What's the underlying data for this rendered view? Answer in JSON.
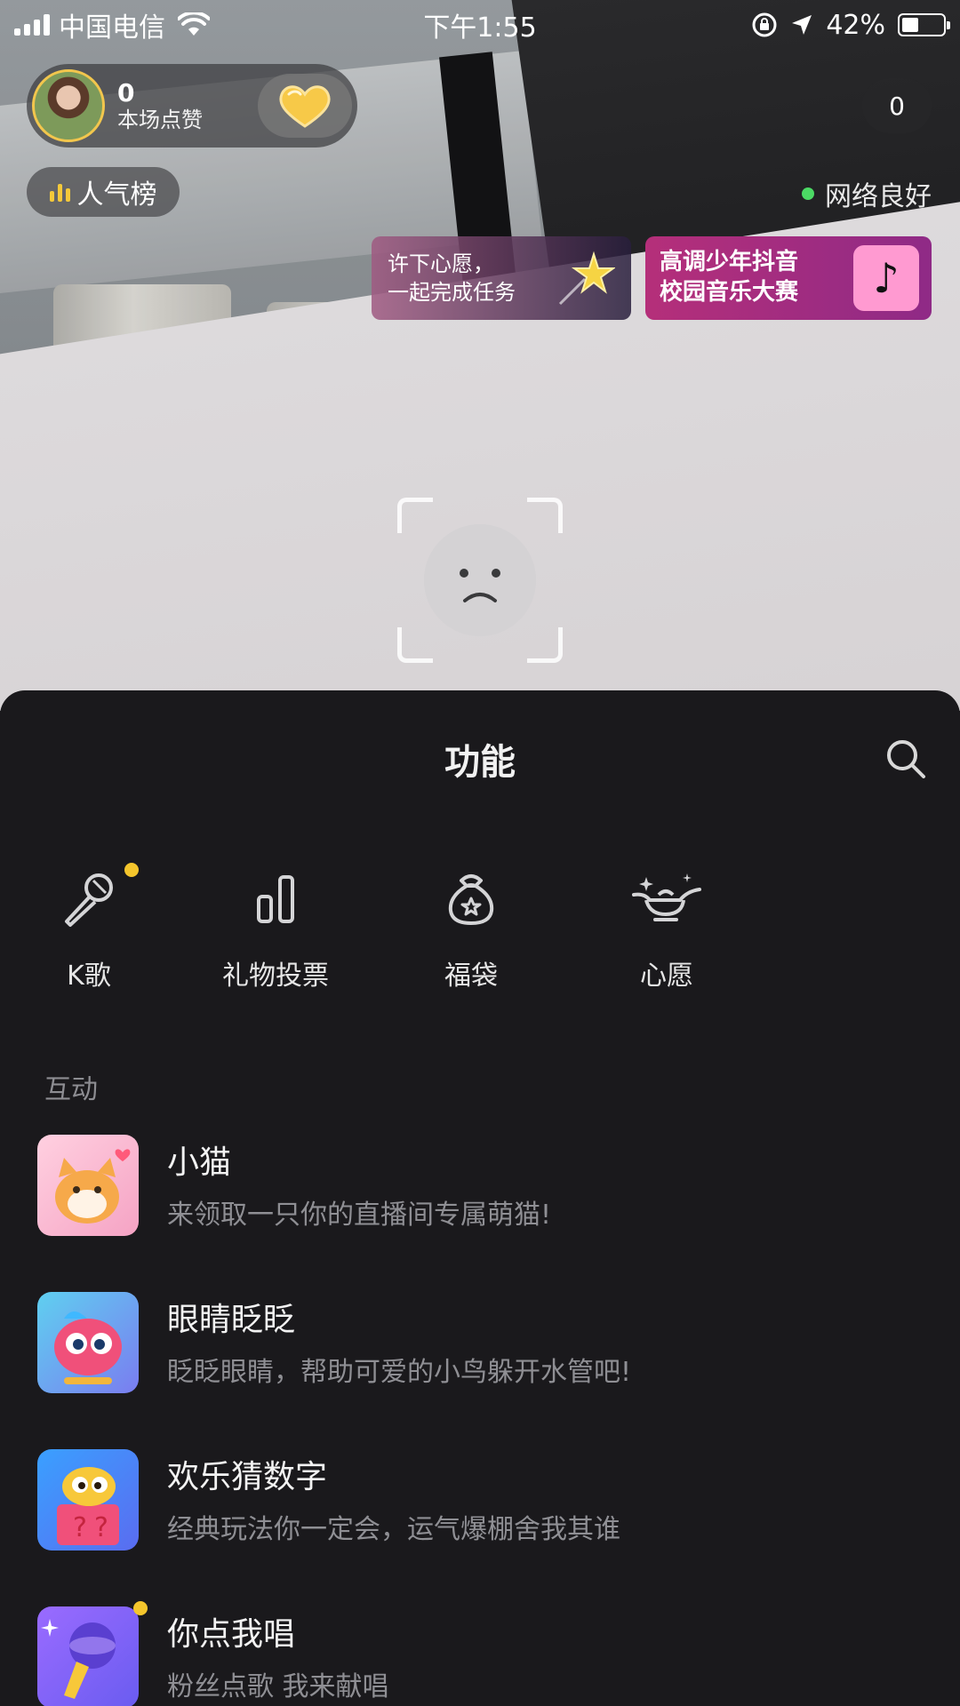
{
  "status_bar": {
    "carrier": "中国电信",
    "time": "下午1:55",
    "battery": "42%",
    "battery_level": 0.42
  },
  "live": {
    "like_count": "0",
    "like_label": "本场点赞",
    "viewer_count": "0",
    "rank_label": "人气榜",
    "network_status": "网络良好",
    "wish_banner": [
      "许下心愿，",
      "一起完成任务"
    ],
    "music_banner": [
      "高调少年抖音",
      "校园音乐大赛"
    ]
  },
  "sheet": {
    "title": "功能",
    "features": [
      {
        "label": "K歌",
        "icon": "microphone-icon",
        "badge": true
      },
      {
        "label": "礼物投票",
        "icon": "bar-chart-icon",
        "badge": false
      },
      {
        "label": "福袋",
        "icon": "lucky-bag-icon",
        "badge": false
      },
      {
        "label": "心愿",
        "icon": "magic-lamp-icon",
        "badge": false
      }
    ],
    "section_label": "互动",
    "games": [
      {
        "name": "小猫",
        "desc": "来领取一只你的直播间专属萌猫!",
        "icon": "cat-game-icon"
      },
      {
        "name": "眼睛眨眨",
        "desc": "眨眨眼睛，帮助可爱的小鸟躲开水管吧!",
        "icon": "bird-game-icon"
      },
      {
        "name": "欢乐猜数字",
        "desc": "经典玩法你一定会，运气爆棚舍我其谁",
        "icon": "guess-number-game-icon"
      },
      {
        "name": "你点我唱",
        "desc": "粉丝点歌 我来献唱",
        "icon": "sing-request-game-icon",
        "badge": true
      }
    ]
  },
  "colors": {
    "sheet_bg": "#1a191c",
    "accent_yellow": "#f4c52c",
    "network_green": "#4bd964",
    "muted_text": "#8f8f94"
  }
}
